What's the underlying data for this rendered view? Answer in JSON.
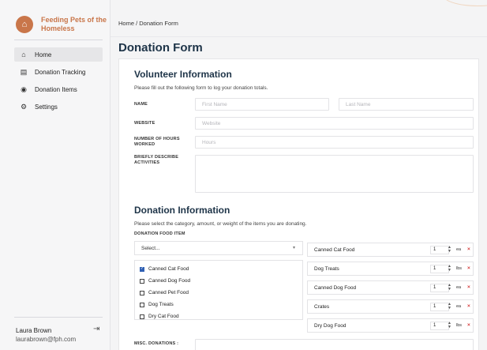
{
  "app": {
    "name": "Feeding Pets of the Homeless",
    "logo_icon": "house-pet-icon",
    "accent_color": "#c9764a",
    "title_color": "#1e3448"
  },
  "sidebar": {
    "items": [
      {
        "label": "Home",
        "icon": "home-icon",
        "active": true
      },
      {
        "label": "Donation Tracking",
        "icon": "document-icon",
        "active": false
      },
      {
        "label": "Donation Items",
        "icon": "heart-icon",
        "active": false
      },
      {
        "label": "Settings",
        "icon": "gear-icon",
        "active": false
      }
    ],
    "user": {
      "name": "Laura Brown",
      "email": "laurabrown@fph.com",
      "logout_icon": "logout-icon"
    }
  },
  "header": {
    "breadcrumb": "Home / Donation Form",
    "page_title": "Donation Form"
  },
  "volunteer": {
    "title": "Volunteer Information",
    "description": "Please fill out the following form to log your donation totals.",
    "fields": {
      "name_label": "NAME",
      "first_name_placeholder": "First Name",
      "last_name_placeholder": "Last Name",
      "website_label": "WEBSITE",
      "website_placeholder": "Website",
      "hours_label": "NUMBER OF HOURS WORKED",
      "hours_placeholder": "Hours",
      "activities_label": "BRIEFLY DESCRIBE ACTIVITIES",
      "activities_value": ""
    }
  },
  "donation": {
    "title": "Donation Information",
    "description": "Please select the category, amount, or weight of the items you are donating.",
    "food_label": "DONATION FOOD ITEM",
    "select_value": "Select...",
    "checklist": [
      {
        "label": "Canned Cat Food",
        "checked": true
      },
      {
        "label": "Canned Dog Food",
        "checked": false
      },
      {
        "label": "Canned Pet Food",
        "checked": false
      },
      {
        "label": "Dog Treats",
        "checked": false
      },
      {
        "label": "Dry Cat Food",
        "checked": false
      }
    ],
    "selected_items": [
      {
        "name": "Canned Cat Food",
        "qty": "1",
        "unit": "ea"
      },
      {
        "name": "Dog Treats",
        "qty": "1",
        "unit": "lbs"
      },
      {
        "name": "Canned Dog Food",
        "qty": "1",
        "unit": "ea"
      },
      {
        "name": "Crates",
        "qty": "1",
        "unit": "ea"
      },
      {
        "name": "Dry Dog Food",
        "qty": "1",
        "unit": "lbs"
      }
    ],
    "misc_label": "MISC. DONATIONS :"
  }
}
